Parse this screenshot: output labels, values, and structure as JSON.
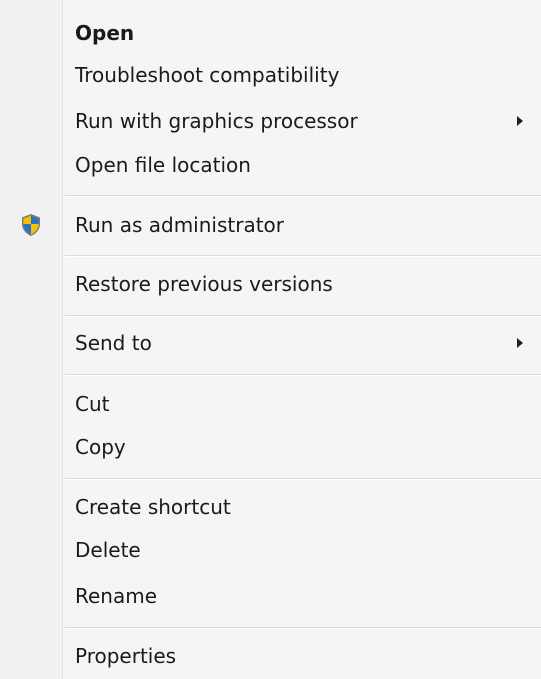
{
  "menu": {
    "items": [
      {
        "label": "Open"
      },
      {
        "label": "Troubleshoot compatibility"
      },
      {
        "label": "Run with graphics processor"
      },
      {
        "label": "Open file location"
      },
      {
        "label": "Run as administrator",
        "icon": "uac-shield-icon"
      },
      {
        "label": "Restore previous versions"
      },
      {
        "label": "Send to"
      },
      {
        "label": "Cut"
      },
      {
        "label": "Copy"
      },
      {
        "label": "Create shortcut"
      },
      {
        "label": "Delete"
      },
      {
        "label": "Rename"
      },
      {
        "label": "Properties"
      }
    ]
  },
  "colors": {
    "background": "#f5f5f5",
    "separator": "#dcdcdc",
    "text": "#1a1a1a",
    "shield_blue": "#2f6fc4",
    "shield_yellow": "#f2c200"
  }
}
